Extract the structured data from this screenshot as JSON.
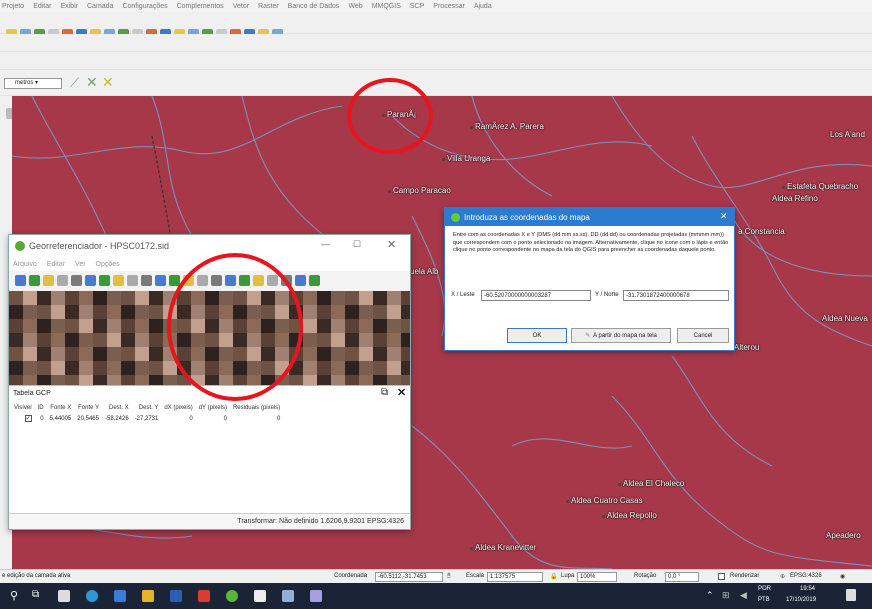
{
  "menu": [
    "Projeto",
    "Editar",
    "Exibir",
    "Camada",
    "Configurações",
    "Complementos",
    "Vetor",
    "Raster",
    "Banco de Dados",
    "Web",
    "MMQGIS",
    "SCP",
    "Processar",
    "Ajuda"
  ],
  "units_combo": "metros",
  "map": {
    "places": [
      "ParanÃ¡",
      "RamÃ­rez A. Parera",
      "Villa Uranga",
      "Campo Paracao",
      "Los A'and",
      "Estafeta Quebracho",
      "Aldea Refino",
      "a Constancia",
      "Aldea Nueva",
      "Aldea El Chaleco",
      "Aldea Cuatro Casas",
      "Aldea Repollo",
      "Apeadero",
      "Aldea Kranevitter",
      "uela Alb",
      "Alterou"
    ]
  },
  "georef": {
    "title": "Georreferenciador - HPSC0172.sid",
    "menu": [
      "Arquivo",
      "Editar",
      "Ver",
      "Opções"
    ],
    "gcp_title": "Tabela GCP",
    "columns": [
      "Visível",
      "ID",
      "Fonte X",
      "Fonte Y",
      "Dest. X",
      "Dest. Y",
      "dX (pixels)",
      "dY (pixels)",
      "Residuais (pixels)"
    ],
    "rows": [
      [
        "",
        "0",
        "5,44005",
        "20,5465",
        "-58,2426",
        "-27,2731",
        "0",
        "0",
        "0"
      ]
    ],
    "status": "Transformar: Não definido   1.6206,9.9201   EPSG:4326"
  },
  "dialog": {
    "title": "Introduza as coordenadas do mapa",
    "text": "Entre com as coordenadas X e Y (DMS (dd mm ss.ss), DD (dd.dd) ou coordenadas projetadas (mmmm.mm)) que correspondem com o ponto selecionado na imagem. Alternativamente, clique no ícone com o lápis e então clique no ponto correspondente no mapa da tela do QGIS para preencher as coordenadas daquele ponto.",
    "x_label": "X / Leste",
    "x_value": "-60.52070000000003287",
    "y_label": "Y / Norte",
    "y_value": "-31.7301872400000678",
    "ok": "OK",
    "from_canvas": "A partir do mapa na tela",
    "cancel": "Cancel"
  },
  "statusbar": {
    "left": "e edição da camada ativa",
    "coord_label": "Coordenada",
    "coord_value": "-60.5112,-31.7453",
    "scale_label": "Escala",
    "scale_value": "1:137575",
    "zoom_label": "Lupa",
    "zoom_value": "100%",
    "rotation_label": "Rotação",
    "rotation_value": "0,0 °",
    "render_label": "Renderizar",
    "epsg": "EPSG:4326"
  },
  "taskbar": {
    "lang1": "POR",
    "lang2": "PTB",
    "time": "19:54",
    "date": "17/10/2019"
  }
}
